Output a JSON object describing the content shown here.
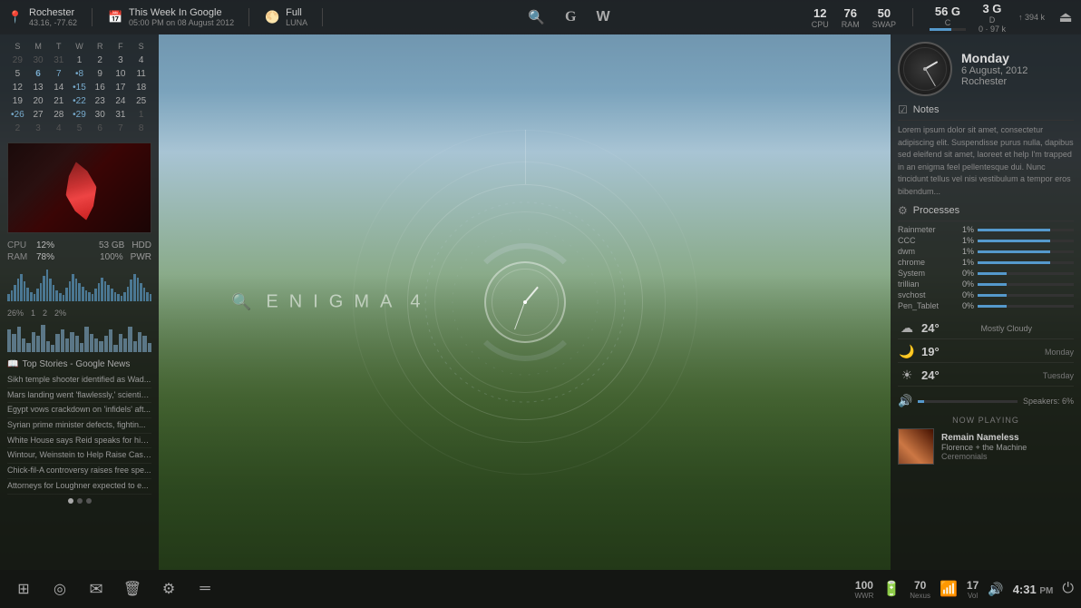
{
  "topbar": {
    "location": "Rochester",
    "coords": "43.16, -77.62",
    "calendar_icon": "📅",
    "this_week": "This Week In Google",
    "this_week_sub": "05:00 PM on 08 August 2012",
    "moon_icon": "🌕",
    "moon_phase": "Full",
    "moon_sub": "LUNA",
    "search_label": "🔍",
    "google_label": "G",
    "wiki_label": "W",
    "cpu_val": "12",
    "cpu_lbl": "CPU",
    "ram_val": "76",
    "ram_lbl": "RAM",
    "swap_val": "50",
    "swap_lbl": "SWAP",
    "drive_val": "56 G",
    "drive_lbl": "C",
    "net_val": "3 G",
    "net_lbl": "D",
    "net_sub": "0 · 97 k",
    "upload_lbl": "↑ 394 k"
  },
  "clock": {
    "day": "Monday",
    "date": "6 August, 2012",
    "city": "Rochester"
  },
  "calendar": {
    "headers": [
      "S",
      "M",
      "T",
      "W",
      "R",
      "F",
      "S"
    ],
    "weeks": [
      [
        "29",
        "30",
        "31",
        "1",
        "2",
        "3",
        "4"
      ],
      [
        "5",
        "6",
        "7",
        "•8",
        "9",
        "10",
        "11"
      ],
      [
        "12",
        "13",
        "14",
        "•15",
        "16",
        "17",
        "18"
      ],
      [
        "19",
        "20",
        "21",
        "•22",
        "23",
        "24",
        "25"
      ],
      [
        "•26",
        "27",
        "28",
        "•29",
        "30",
        "31",
        "1"
      ],
      [
        "2",
        "3",
        "4",
        "5",
        "6",
        "7",
        "8"
      ]
    ]
  },
  "sys": {
    "cpu_label": "CPU",
    "cpu_val": "12%",
    "hdd_val": "53 GB",
    "hdd_label": "HDD",
    "ram_label": "RAM",
    "ram_val": "78%",
    "pwr_val": "100%",
    "pwr_label": "PWR",
    "vol_val": "26%",
    "vol_num1": "1",
    "vol_num2": "2",
    "vol_pct": "2%"
  },
  "news": {
    "header": "Top Stories - Google News",
    "items": [
      "Sikh temple shooter identified as Wad...",
      "Mars landing went 'flawlessly,' scientis...",
      "Egypt vows crackdown on 'infidels' aft...",
      "Syrian prime minister defects, fightin...",
      "White House says Reid speaks for him...",
      "Wintour, Weinstein to Help Raise Cash...",
      "Chick-fil-A controversy raises free spe...",
      "Attorneys for Loughner expected to e..."
    ]
  },
  "notes": {
    "header": "Notes",
    "text": "Lorem ipsum dolor sit amet, consectetur adipiscing elit. Suspendisse purus nulla, dapibus sed eleifend sit amet, laoreet et help I'm trapped in an enigma feel pellentesque dui. Nunc tincidunt tellus vel nisi vestibulum a tempor eros bibendum..."
  },
  "processes": {
    "header": "Processes",
    "items": [
      {
        "name": "Rainmeter",
        "pct": "1%",
        "bar": 5
      },
      {
        "name": "CCC",
        "pct": "1%",
        "bar": 5
      },
      {
        "name": "dwm",
        "pct": "1%",
        "bar": 5
      },
      {
        "name": "chrome",
        "pct": "1%",
        "bar": 5
      },
      {
        "name": "System",
        "pct": "0%",
        "bar": 2
      },
      {
        "name": "trillian",
        "pct": "0%",
        "bar": 2
      },
      {
        "name": "svchost",
        "pct": "0%",
        "bar": 2
      },
      {
        "name": "Pen_Tablet",
        "pct": "0%",
        "bar": 2
      }
    ]
  },
  "weather": {
    "items": [
      {
        "icon": "☁",
        "temp": "24°",
        "desc": "Mostly Cloudy",
        "day": ""
      },
      {
        "icon": "🌙",
        "temp": "19°",
        "desc": "",
        "day": "Monday"
      },
      {
        "icon": "☀",
        "temp": "24°",
        "desc": "",
        "day": "Tuesday"
      }
    ]
  },
  "volume": {
    "icon": "🔊",
    "label": "Speakers: 6%",
    "pct": 6
  },
  "now_playing": {
    "header": "Now Playing",
    "title": "Remain Nameless",
    "artist": "Florence + the Machine",
    "album": "Ceremonials"
  },
  "enigma": {
    "logo_text": "ENIGMA",
    "version": "4"
  },
  "taskbar": {
    "start_icon": "⊞",
    "btn2": "◎",
    "btn3": "✉",
    "btn4": "🗑",
    "btn5": "⚙",
    "btn6": "═",
    "wwr_val": "100",
    "wwr_lbl": "WWR",
    "nexus_val": "70",
    "nexus_lbl": "Nexus",
    "vol_icon": "🔊",
    "vol_val": "17",
    "vol_lbl": "Vol",
    "time": "4:31",
    "am_pm": "PM"
  }
}
